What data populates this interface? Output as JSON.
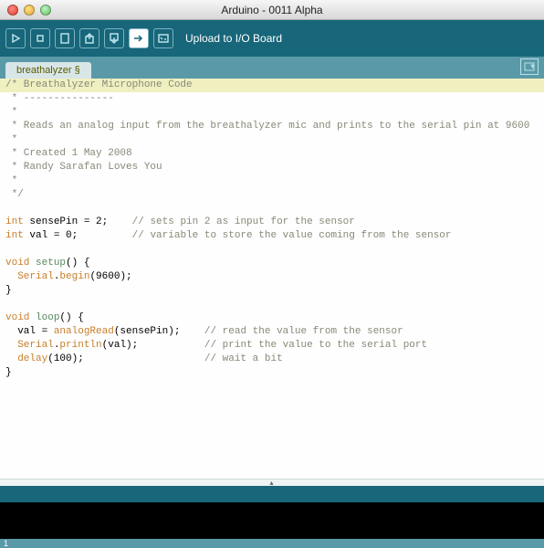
{
  "window": {
    "title": "Arduino - 0011 Alpha"
  },
  "toolbar": {
    "buttons": [
      {
        "name": "verify",
        "hint": "Verify"
      },
      {
        "name": "stop",
        "hint": "Stop"
      },
      {
        "name": "new",
        "hint": "New"
      },
      {
        "name": "open",
        "hint": "Open"
      },
      {
        "name": "save",
        "hint": "Save"
      },
      {
        "name": "upload",
        "hint": "Upload to I/O Board",
        "active": true
      },
      {
        "name": "serial",
        "hint": "Serial Monitor"
      }
    ],
    "hint": "Upload to I/O Board"
  },
  "tabs": {
    "items": [
      {
        "label": "breathalyzer §"
      }
    ]
  },
  "code": {
    "lines": [
      {
        "hl": true,
        "segs": [
          {
            "c": "c-comment",
            "t": "/* Breathalyzer Microphone Code"
          }
        ]
      },
      {
        "segs": [
          {
            "c": "c-comment",
            "t": " * ---------------"
          }
        ]
      },
      {
        "segs": [
          {
            "c": "c-comment",
            "t": " *"
          }
        ]
      },
      {
        "segs": [
          {
            "c": "c-comment",
            "t": " * Reads an analog input from the breathalyzer mic and prints to the serial pin at 9600"
          }
        ]
      },
      {
        "segs": [
          {
            "c": "c-comment",
            "t": " *"
          }
        ]
      },
      {
        "segs": [
          {
            "c": "c-comment",
            "t": " * Created 1 May 2008"
          }
        ]
      },
      {
        "segs": [
          {
            "c": "c-comment",
            "t": " * Randy Sarafan Loves You"
          }
        ]
      },
      {
        "segs": [
          {
            "c": "c-comment",
            "t": " *"
          }
        ]
      },
      {
        "segs": [
          {
            "c": "c-comment",
            "t": " */"
          }
        ]
      },
      {
        "segs": [
          {
            "t": ""
          }
        ]
      },
      {
        "segs": [
          {
            "c": "c-type",
            "t": "int"
          },
          {
            "t": " sensePin = 2;    "
          },
          {
            "c": "c-comment",
            "t": "// sets pin 2 as input for the sensor"
          }
        ]
      },
      {
        "segs": [
          {
            "c": "c-type",
            "t": "int"
          },
          {
            "t": " val = 0;         "
          },
          {
            "c": "c-comment",
            "t": "// variable to store the value coming from the sensor"
          }
        ]
      },
      {
        "segs": [
          {
            "t": ""
          }
        ]
      },
      {
        "segs": [
          {
            "c": "c-type",
            "t": "void"
          },
          {
            "t": " "
          },
          {
            "c": "c-key",
            "t": "setup"
          },
          {
            "t": "() {"
          }
        ]
      },
      {
        "segs": [
          {
            "t": "  "
          },
          {
            "c": "c-fn",
            "t": "Serial"
          },
          {
            "t": "."
          },
          {
            "c": "c-fn",
            "t": "begin"
          },
          {
            "t": "(9600);"
          }
        ]
      },
      {
        "segs": [
          {
            "t": "}"
          }
        ]
      },
      {
        "segs": [
          {
            "t": ""
          }
        ]
      },
      {
        "segs": [
          {
            "c": "c-type",
            "t": "void"
          },
          {
            "t": " "
          },
          {
            "c": "c-key",
            "t": "loop"
          },
          {
            "t": "() {"
          }
        ]
      },
      {
        "segs": [
          {
            "t": "  val = "
          },
          {
            "c": "c-fn",
            "t": "analogRead"
          },
          {
            "t": "(sensePin);    "
          },
          {
            "c": "c-comment",
            "t": "// read the value from the sensor"
          }
        ]
      },
      {
        "segs": [
          {
            "t": "  "
          },
          {
            "c": "c-fn",
            "t": "Serial"
          },
          {
            "t": "."
          },
          {
            "c": "c-fn",
            "t": "println"
          },
          {
            "t": "(val);           "
          },
          {
            "c": "c-comment",
            "t": "// print the value to the serial port"
          }
        ]
      },
      {
        "segs": [
          {
            "t": "  "
          },
          {
            "c": "c-fn",
            "t": "delay"
          },
          {
            "t": "(100);                    "
          },
          {
            "c": "c-comment",
            "t": "// wait a bit"
          }
        ]
      },
      {
        "segs": [
          {
            "t": "}"
          }
        ]
      }
    ]
  },
  "footer": {
    "line": "1"
  }
}
